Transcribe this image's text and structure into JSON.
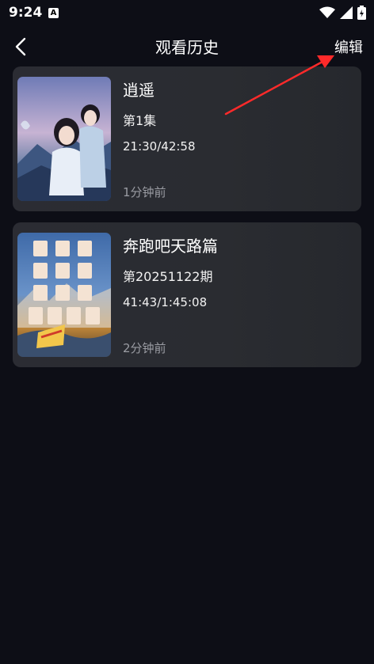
{
  "status_bar": {
    "time": "9:24",
    "notification_icon": "a-letter-icon"
  },
  "header": {
    "back_icon": "chevron-left-icon",
    "title": "观看历史",
    "edit_label": "编辑"
  },
  "history": [
    {
      "title": "逍遥",
      "episode": "第1集",
      "progress": "21:30/42:58",
      "ago": "1分钟前",
      "thumbnail": "poster-xiaoyao"
    },
    {
      "title": "奔跑吧天路篇",
      "episode": "第20251122期",
      "progress": "41:43/1:45:08",
      "ago": "2分钟前",
      "thumbnail": "poster-running-man"
    }
  ],
  "annotation": {
    "color": "#ff2a2a",
    "points_to": "edit"
  }
}
